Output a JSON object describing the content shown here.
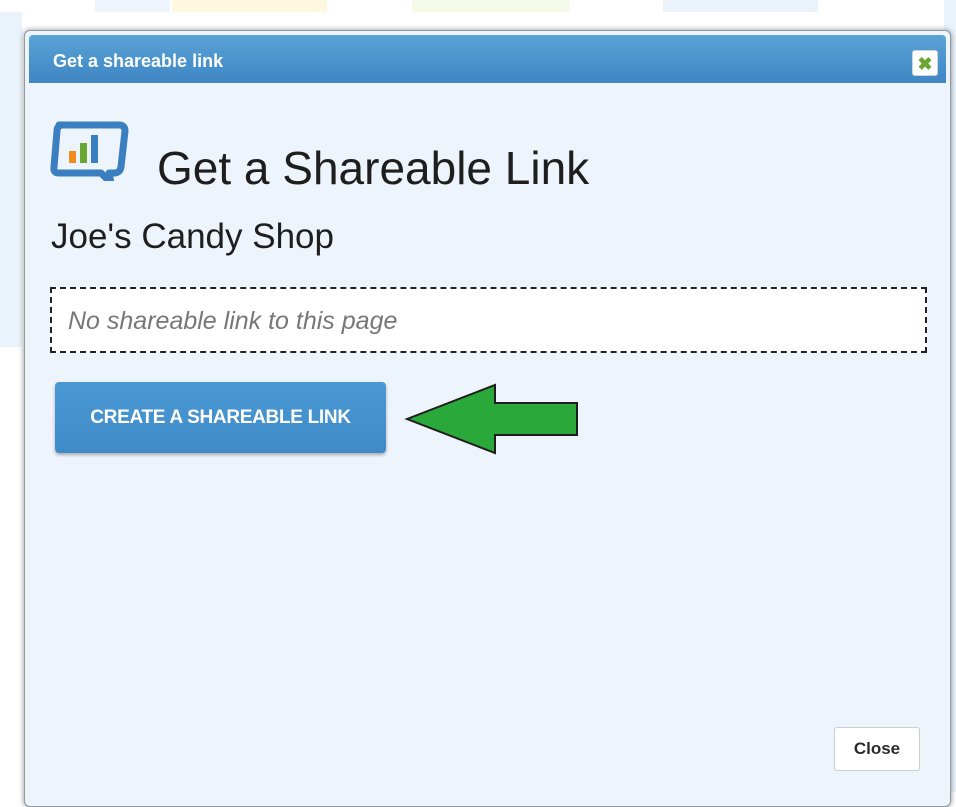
{
  "dialog": {
    "title": "Get a shareable link",
    "close_icon_glyph": "✖",
    "heading": "Get a Shareable Link",
    "page_name": "Joe's Candy Shop",
    "link_field": {
      "value": "No shareable link to this page"
    },
    "create_button_label": "CREATE A SHAREABLE LINK",
    "close_button_label": "Close"
  },
  "icons": {
    "logo": "chart-speech-bubble-icon",
    "titlebar_close": "close-icon",
    "annotation": "green-arrow-left-icon"
  },
  "colors": {
    "titlebar": "#4a95d0",
    "accent_button": "#4390cc",
    "arrow_fill": "#2aa83a",
    "close_icon": "#6aa632",
    "dialog_background": "#eef4fb"
  }
}
